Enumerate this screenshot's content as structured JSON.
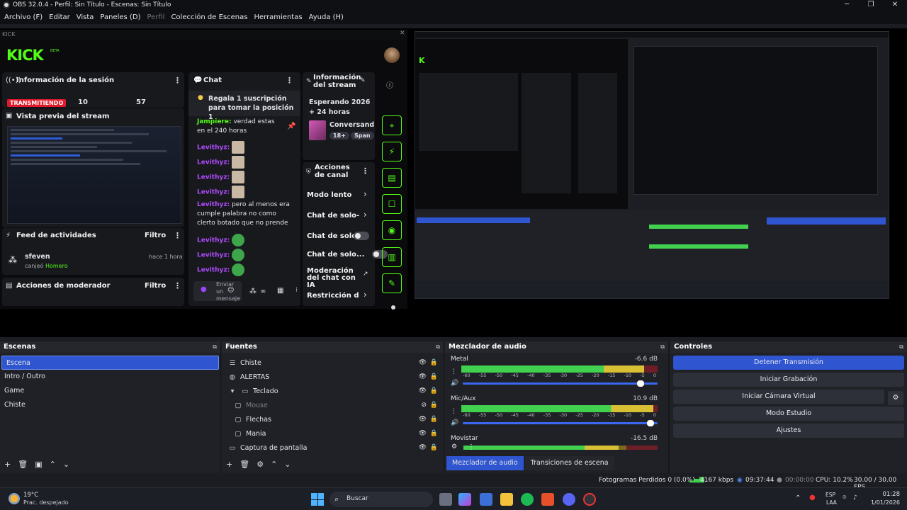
{
  "window": {
    "title": "OBS 32.0.4 - Perfil: Sin Título - Escenas: Sin Título"
  },
  "menu": [
    "Archivo (F)",
    "Editar",
    "Vista",
    "Paneles (D)",
    "Perfil",
    "Colección de Escenas",
    "Herramientas",
    "Ayuda (H)"
  ],
  "dock_title": "KICK",
  "kick": {
    "logo": "KICK",
    "logo_sup": "BETA",
    "session": {
      "title": "Información de la sesión",
      "live_badge": "TRANSMITIENDO",
      "stat1": "10",
      "stat2": "57"
    },
    "preview_title": "Vista previa del stream",
    "activity": {
      "title": "Feed de actividades",
      "filter": "Filtro",
      "user": "sfeven",
      "time": "hace 1 hora",
      "desc_prefix": "canjeó",
      "desc_item": "Homero"
    },
    "moderator": {
      "title": "Acciones de moderador",
      "filter": "Filtro"
    },
    "chat": {
      "title": "Chat",
      "pinned": "Regala 1 suscripción para tomar la posición 1",
      "messages": [
        {
          "user": "Jampiere:",
          "text": "verdad estas en el 240 horas"
        },
        {
          "user": "Levithyz:",
          "text": ""
        },
        {
          "user": "Levithyz:",
          "text": ""
        },
        {
          "user": "Levithyz:",
          "text": ""
        },
        {
          "user": "Levithyz:",
          "text": ""
        },
        {
          "user": "Levithyz:",
          "text": "pero al menos era cumple palabra no como clerto botado que no prende"
        },
        {
          "user": "Levithyz:",
          "text": ""
        },
        {
          "user": "Levithyz:",
          "text": ""
        },
        {
          "user": "Levithyz:",
          "text": ""
        }
      ],
      "input_placeholder": "Enviar un mensaje"
    },
    "stream_info": {
      "title": "Información del stream",
      "stream_title": "Esperando 2026 + 24 horas",
      "category": "Conversand",
      "tag1": "18+",
      "tag2": "Span"
    },
    "channel_actions": {
      "title": "Acciones de canal",
      "items": [
        "Modo lento",
        "Chat de solo-seg",
        "Chat de solo...",
        "Chat de solo...",
        "Moderación del chat con IA",
        "Restricción de e"
      ]
    }
  },
  "docks": {
    "scenes": {
      "title": "Escenas",
      "items": [
        "Escena",
        "Intro / Outro",
        "Game",
        "Chiste"
      ]
    },
    "sources": {
      "title": "Fuentes",
      "items": [
        "Chiste",
        "ALERTAS",
        "Teclado",
        "Mouse",
        "Flechas",
        "Mania",
        "Captura de pantalla"
      ]
    },
    "mixer": {
      "title": "Mezclador de audio",
      "channels": [
        {
          "name": "Metal",
          "db": "-6.6 dB",
          "level": 0.93
        },
        {
          "name": "Mic/Aux",
          "db": "10.9 dB",
          "level": 0.98
        },
        {
          "name": "Movistar",
          "db": "-16.5 dB",
          "level": 0.8
        }
      ],
      "scale": [
        "-60",
        "-55",
        "-50",
        "-45",
        "-40",
        "-35",
        "-30",
        "-25",
        "-20",
        "-15",
        "-10",
        "-5",
        "0"
      ]
    },
    "controls": {
      "title": "Controles",
      "buttons": [
        "Detener Transmisión",
        "Iniciar Grabación",
        "Iniciar Cámara Virtual",
        "Modo Estudio",
        "Ajustes"
      ]
    }
  },
  "tabs": [
    "Mezclador de audio",
    "Transiciones de escena"
  ],
  "status": {
    "dropped": "Fotogramas Perdidos 0 (0.0%)",
    "bitrate": "4167 kbps",
    "live_time": "09:37:44",
    "rec_time": "00:00:00",
    "cpu": "CPU: 10.2%",
    "fps": "30.00 / 30.00 FPS"
  },
  "taskbar": {
    "weather_temp": "19°C",
    "weather_desc": "Prac. despejado",
    "search": "Buscar",
    "lang1": "ESP",
    "lang2": "LAA",
    "time": "01:28",
    "date": "1/01/2026"
  }
}
